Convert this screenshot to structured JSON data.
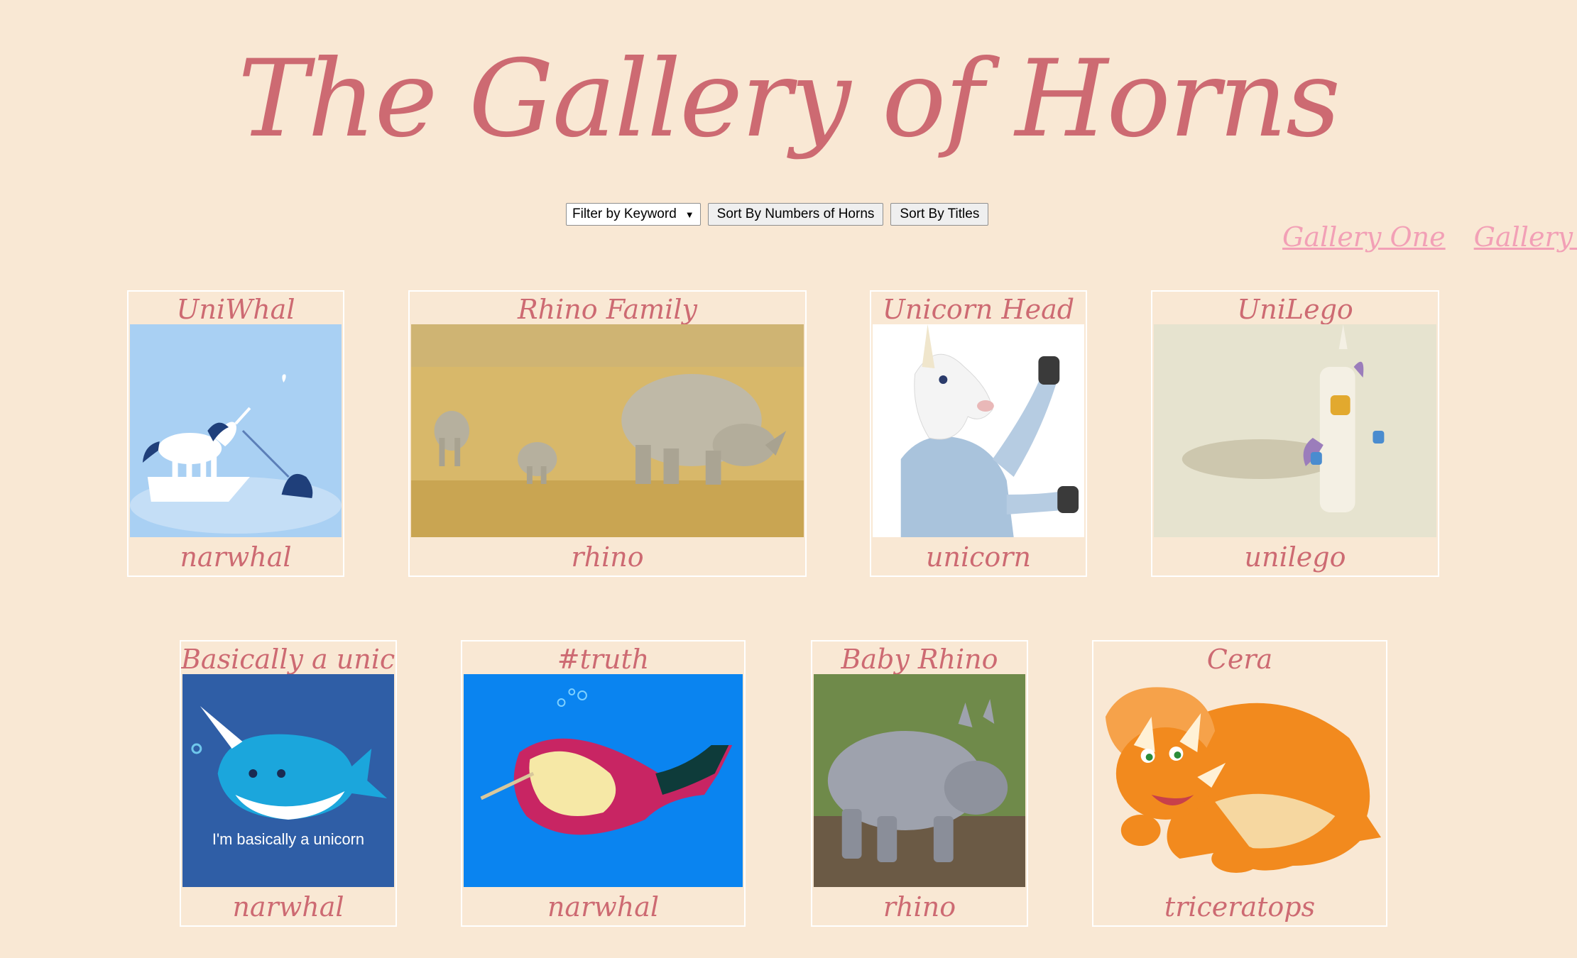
{
  "page": {
    "title": "The Gallery of Horns"
  },
  "controls": {
    "filter_label": "Filter by Keyword",
    "sort_horns_label": "Sort By Numbers of Horns",
    "sort_titles_label": "Sort By Titles"
  },
  "nav": {
    "gallery_one": "Gallery One",
    "gallery_two": "Gallery Two"
  },
  "colors": {
    "background": "#f9e8d4",
    "title": "#cd6a72",
    "nav_link": "#f2a0b6"
  },
  "gallery": [
    {
      "title": "UniWhal",
      "keyword": "narwhal"
    },
    {
      "title": "Rhino Family",
      "keyword": "rhino"
    },
    {
      "title": "Unicorn Head",
      "keyword": "unicorn"
    },
    {
      "title": "UniLego",
      "keyword": "unilego"
    },
    {
      "title": "Basically a unicorn",
      "keyword": "narwhal",
      "image_caption": "I'm basically a unicorn"
    },
    {
      "title": "#truth",
      "keyword": "narwhal"
    },
    {
      "title": "Baby Rhino",
      "keyword": "rhino"
    },
    {
      "title": "Cera",
      "keyword": "triceratops"
    }
  ]
}
